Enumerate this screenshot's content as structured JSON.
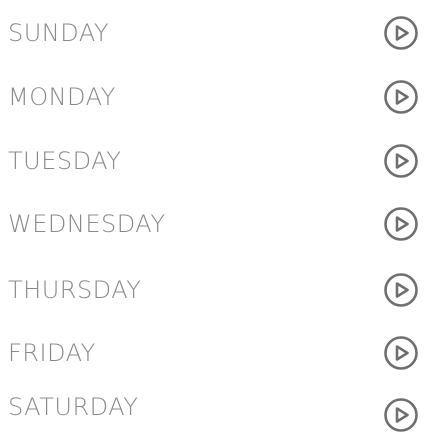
{
  "days": [
    {
      "label": "SUNDAY",
      "icon": "play-circle-icon"
    },
    {
      "label": "MONDAY",
      "icon": "play-circle-icon"
    },
    {
      "label": "TUESDAY",
      "icon": "play-circle-icon"
    },
    {
      "label": "WEDNESDAY",
      "icon": "play-circle-icon"
    },
    {
      "label": "THURSDAY",
      "icon": "play-circle-icon"
    },
    {
      "label": "FRIDAY",
      "icon": "play-circle-icon"
    },
    {
      "label": "SATURDAY",
      "icon": "play-circle-icon"
    }
  ],
  "colors": {
    "text": "#888888",
    "icon": "#6f6f6f",
    "background": "#ffffff"
  }
}
